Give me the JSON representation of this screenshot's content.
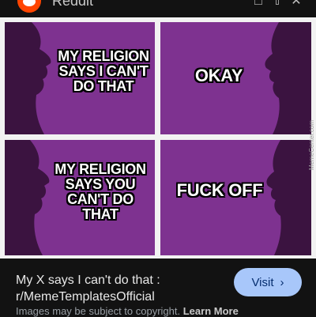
{
  "header": {
    "site_name": "Reddit",
    "logo_icon": "reddit-logo-icon",
    "actions": [
      "bookmark-icon",
      "share-icon",
      "close-icon"
    ]
  },
  "meme": {
    "panels": [
      {
        "text": "MY RELIGION SAYS I CAN'T DO THAT"
      },
      {
        "text": "OKAY"
      },
      {
        "text": "MY RELIGION SAYS YOU CAN'T DO THAT"
      },
      {
        "text": "FUCK OFF"
      }
    ],
    "watermark": "MemeCenter.com",
    "panel_color": "#7a2f8a"
  },
  "result": {
    "caption_line1": "My X says I can't do that :",
    "caption_line2": "r/MemeTemplatesOfficial",
    "visit_label": "Visit",
    "visit_icon": "chevron-right-icon",
    "copyright_text": "Images may be subject to copyright.",
    "learn_more": "Learn More"
  },
  "colors": {
    "background": "#121212",
    "visit_button": "#a8c7fa",
    "brand": "#ff4500"
  }
}
